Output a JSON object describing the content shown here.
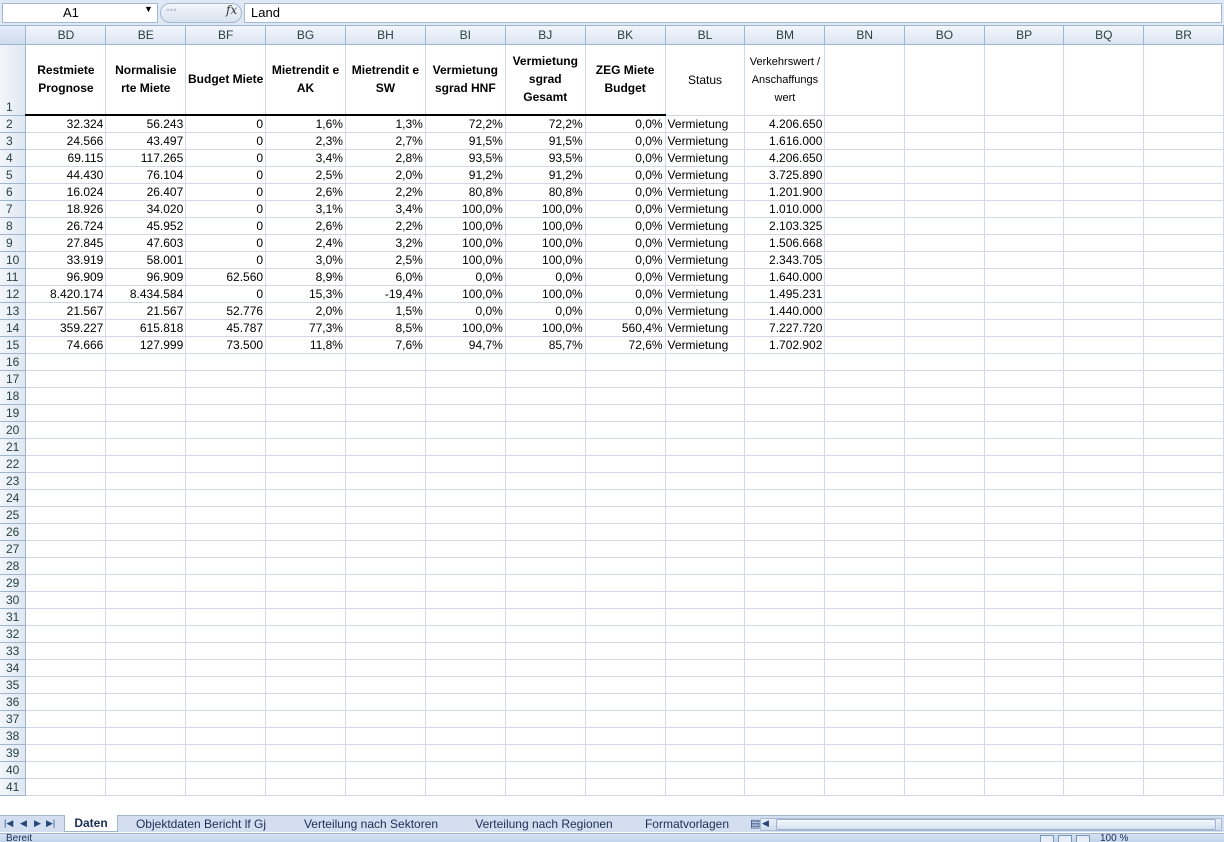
{
  "formula_bar": {
    "cell_ref": "A1",
    "fx_label": "fx",
    "content": "Land"
  },
  "columns": [
    "BD",
    "BE",
    "BF",
    "BG",
    "BH",
    "BI",
    "BJ",
    "BK",
    "BL",
    "BM",
    "BN",
    "BO",
    "BP",
    "BQ",
    "BR"
  ],
  "headers": [
    "Restmiete Prognose",
    "Normalisie rte Miete",
    "Budget Miete",
    "Mietrendit e AK",
    "Mietrendit e SW",
    "Vermietung sgrad HNF",
    "Vermietung sgrad Gesamt",
    "ZEG Miete Budget",
    "Status",
    "Verkehrswert / Anschaffungs wert"
  ],
  "rows": [
    [
      "32.324",
      "56.243",
      "0",
      "1,6%",
      "1,3%",
      "72,2%",
      "72,2%",
      "0,0%",
      "Vermietung",
      "4.206.650"
    ],
    [
      "24.566",
      "43.497",
      "0",
      "2,3%",
      "2,7%",
      "91,5%",
      "91,5%",
      "0,0%",
      "Vermietung",
      "1.616.000"
    ],
    [
      "69.115",
      "117.265",
      "0",
      "3,4%",
      "2,8%",
      "93,5%",
      "93,5%",
      "0,0%",
      "Vermietung",
      "4.206.650"
    ],
    [
      "44.430",
      "76.104",
      "0",
      "2,5%",
      "2,0%",
      "91,2%",
      "91,2%",
      "0,0%",
      "Vermietung",
      "3.725.890"
    ],
    [
      "16.024",
      "26.407",
      "0",
      "2,6%",
      "2,2%",
      "80,8%",
      "80,8%",
      "0,0%",
      "Vermietung",
      "1.201.900"
    ],
    [
      "18.926",
      "34.020",
      "0",
      "3,1%",
      "3,4%",
      "100,0%",
      "100,0%",
      "0,0%",
      "Vermietung",
      "1.010.000"
    ],
    [
      "26.724",
      "45.952",
      "0",
      "2,6%",
      "2,2%",
      "100,0%",
      "100,0%",
      "0,0%",
      "Vermietung",
      "2.103.325"
    ],
    [
      "27.845",
      "47.603",
      "0",
      "2,4%",
      "3,2%",
      "100,0%",
      "100,0%",
      "0,0%",
      "Vermietung",
      "1.506.668"
    ],
    [
      "33.919",
      "58.001",
      "0",
      "3,0%",
      "2,5%",
      "100,0%",
      "100,0%",
      "0,0%",
      "Vermietung",
      "2.343.705"
    ],
    [
      "96.909",
      "96.909",
      "62.560",
      "8,9%",
      "6,0%",
      "0,0%",
      "0,0%",
      "0,0%",
      "Vermietung",
      "1.640.000"
    ],
    [
      "8.420.174",
      "8.434.584",
      "0",
      "15,3%",
      "-19,4%",
      "100,0%",
      "100,0%",
      "0,0%",
      "Vermietung",
      "1.495.231"
    ],
    [
      "21.567",
      "21.567",
      "52.776",
      "2,0%",
      "1,5%",
      "0,0%",
      "0,0%",
      "0,0%",
      "Vermietung",
      "1.440.000"
    ],
    [
      "359.227",
      "615.818",
      "45.787",
      "77,3%",
      "8,5%",
      "100,0%",
      "100,0%",
      "560,4%",
      "Vermietung",
      "7.227.720"
    ],
    [
      "74.666",
      "127.999",
      "73.500",
      "11,8%",
      "7,6%",
      "94,7%",
      "85,7%",
      "72,6%",
      "Vermietung",
      "1.702.902"
    ]
  ],
  "first_data_row": 2,
  "last_row_number": 41,
  "sheet_tabs": [
    "Daten",
    "Objektdaten Bericht lf Gj",
    "Verteilung nach Sektoren",
    "Verteilung nach Regionen",
    "Formatvorlagen"
  ],
  "active_tab": "Daten",
  "status": {
    "text": "Bereit",
    "zoom": "100 %"
  }
}
